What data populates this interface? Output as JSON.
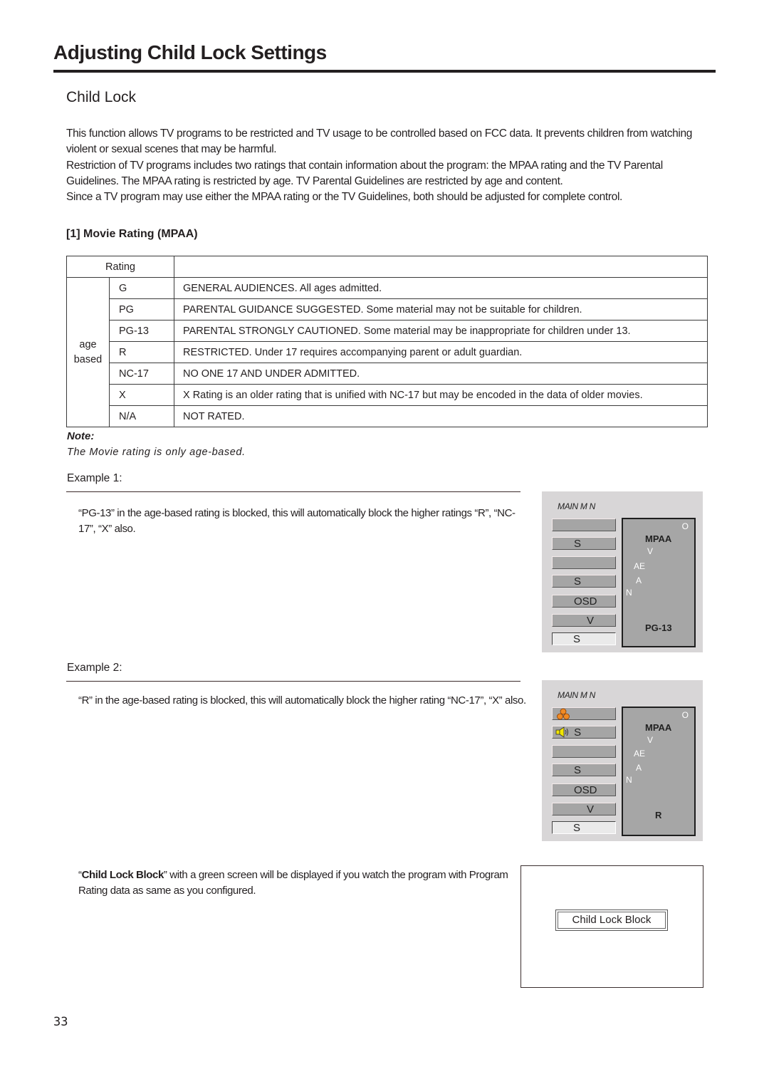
{
  "page_title": "Adjusting Child Lock Settings",
  "section_title": "Child Lock",
  "intro_paragraphs": [
    "This function allows TV programs to be restricted and TV usage to be controlled based on FCC data. It prevents children from watching violent or sexual scenes that may be harmful.",
    "Restriction of TV programs includes two ratings that contain information about the program: the MPAA rating and the TV Parental Guidelines. The MPAA rating is restricted by age. TV Parental Guidelines are restricted by age and content.",
    "Since a TV program may use either the MPAA rating or the TV Guidelines, both should be adjusted for complete control."
  ],
  "movie_rating": {
    "heading": "[1] Movie Rating (MPAA)",
    "table": {
      "header_rating": "Rating",
      "header_description": "",
      "group_label_line1": "age",
      "group_label_line2": "based",
      "rows": [
        {
          "code": "G",
          "description": "GENERAL AUDIENCES. All ages admitted."
        },
        {
          "code": "PG",
          "description": "PARENTAL GUIDANCE SUGGESTED. Some material may not be suitable for children."
        },
        {
          "code": "PG-13",
          "description": "PARENTAL STRONGLY CAUTIONED. Some material may be inappropriate for children under 13."
        },
        {
          "code": "R",
          "description": "RESTRICTED. Under 17 requires accompanying parent or adult guardian."
        },
        {
          "code": "NC-17",
          "description": "NO ONE 17 AND UNDER ADMITTED."
        },
        {
          "code": "X",
          "description": "X Rating is an older rating that is unified with NC-17 but may be encoded in the data of older movies."
        },
        {
          "code": "N/A",
          "description": "NOT RATED."
        }
      ]
    },
    "note_label": "Note:",
    "note_text": "The Movie rating is only age-based."
  },
  "examples": [
    {
      "label": "Example 1:",
      "text": "“PG-13” in the age-based rating is blocked, this will automatically block the higher ratings “R”, “NC-17”, “X” also.",
      "osd": {
        "menu_title": "MAIN M    N",
        "buttons": [
          "",
          "S",
          "",
          "S",
          "OSD",
          "V",
          "S"
        ],
        "panel_corner": "O",
        "panel_title": "MPAA",
        "panel_items": [
          "V",
          "AE",
          "A",
          "N"
        ],
        "panel_value": "PG-13"
      }
    },
    {
      "label": "Example 2:",
      "text": "“R” in the age-based rating is blocked, this will automatically block the higher rating “NC-17”, “X” also.",
      "osd": {
        "menu_title": "MAIN M    N",
        "buttons": [
          "",
          "S",
          "",
          "S",
          "OSD",
          "V",
          "S"
        ],
        "panel_corner": "O",
        "panel_title": "MPAA",
        "panel_items": [
          "V",
          "AE",
          "A",
          "N"
        ],
        "panel_value": "R"
      }
    }
  ],
  "block_notice": {
    "bold_text": "Child Lock Block",
    "text_before": "“",
    "text_after": "” with a green screen will be displayed if you watch the program with Program Rating data as same as you configured.",
    "screen_label": "Child Lock Block"
  },
  "page_number": "33",
  "colors": {
    "text": "#231f20",
    "osd_background": "#d8d6d7",
    "osd_button": "#a5a5a5",
    "osd_panel": "#a6a6a6",
    "picture_icon": "#f08a24",
    "speaker_icon": "#f2e600"
  }
}
